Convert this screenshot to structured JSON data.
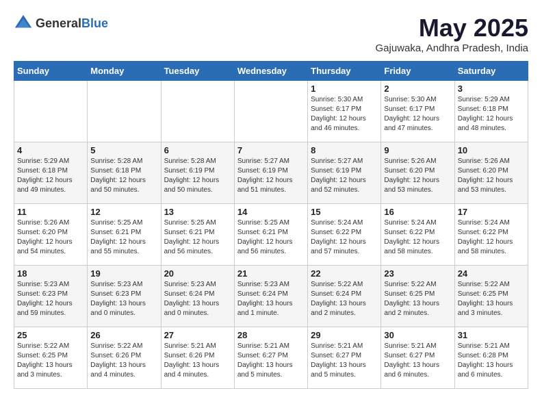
{
  "header": {
    "logo_general": "General",
    "logo_blue": "Blue",
    "month_title": "May 2025",
    "subtitle": "Gajuwaka, Andhra Pradesh, India"
  },
  "days_of_week": [
    "Sunday",
    "Monday",
    "Tuesday",
    "Wednesday",
    "Thursday",
    "Friday",
    "Saturday"
  ],
  "weeks": [
    [
      {
        "day": "",
        "info": ""
      },
      {
        "day": "",
        "info": ""
      },
      {
        "day": "",
        "info": ""
      },
      {
        "day": "",
        "info": ""
      },
      {
        "day": "1",
        "info": "Sunrise: 5:30 AM\nSunset: 6:17 PM\nDaylight: 12 hours\nand 46 minutes."
      },
      {
        "day": "2",
        "info": "Sunrise: 5:30 AM\nSunset: 6:17 PM\nDaylight: 12 hours\nand 47 minutes."
      },
      {
        "day": "3",
        "info": "Sunrise: 5:29 AM\nSunset: 6:18 PM\nDaylight: 12 hours\nand 48 minutes."
      }
    ],
    [
      {
        "day": "4",
        "info": "Sunrise: 5:29 AM\nSunset: 6:18 PM\nDaylight: 12 hours\nand 49 minutes."
      },
      {
        "day": "5",
        "info": "Sunrise: 5:28 AM\nSunset: 6:18 PM\nDaylight: 12 hours\nand 50 minutes."
      },
      {
        "day": "6",
        "info": "Sunrise: 5:28 AM\nSunset: 6:19 PM\nDaylight: 12 hours\nand 50 minutes."
      },
      {
        "day": "7",
        "info": "Sunrise: 5:27 AM\nSunset: 6:19 PM\nDaylight: 12 hours\nand 51 minutes."
      },
      {
        "day": "8",
        "info": "Sunrise: 5:27 AM\nSunset: 6:19 PM\nDaylight: 12 hours\nand 52 minutes."
      },
      {
        "day": "9",
        "info": "Sunrise: 5:26 AM\nSunset: 6:20 PM\nDaylight: 12 hours\nand 53 minutes."
      },
      {
        "day": "10",
        "info": "Sunrise: 5:26 AM\nSunset: 6:20 PM\nDaylight: 12 hours\nand 53 minutes."
      }
    ],
    [
      {
        "day": "11",
        "info": "Sunrise: 5:26 AM\nSunset: 6:20 PM\nDaylight: 12 hours\nand 54 minutes."
      },
      {
        "day": "12",
        "info": "Sunrise: 5:25 AM\nSunset: 6:21 PM\nDaylight: 12 hours\nand 55 minutes."
      },
      {
        "day": "13",
        "info": "Sunrise: 5:25 AM\nSunset: 6:21 PM\nDaylight: 12 hours\nand 56 minutes."
      },
      {
        "day": "14",
        "info": "Sunrise: 5:25 AM\nSunset: 6:21 PM\nDaylight: 12 hours\nand 56 minutes."
      },
      {
        "day": "15",
        "info": "Sunrise: 5:24 AM\nSunset: 6:22 PM\nDaylight: 12 hours\nand 57 minutes."
      },
      {
        "day": "16",
        "info": "Sunrise: 5:24 AM\nSunset: 6:22 PM\nDaylight: 12 hours\nand 58 minutes."
      },
      {
        "day": "17",
        "info": "Sunrise: 5:24 AM\nSunset: 6:22 PM\nDaylight: 12 hours\nand 58 minutes."
      }
    ],
    [
      {
        "day": "18",
        "info": "Sunrise: 5:23 AM\nSunset: 6:23 PM\nDaylight: 12 hours\nand 59 minutes."
      },
      {
        "day": "19",
        "info": "Sunrise: 5:23 AM\nSunset: 6:23 PM\nDaylight: 13 hours\nand 0 minutes."
      },
      {
        "day": "20",
        "info": "Sunrise: 5:23 AM\nSunset: 6:24 PM\nDaylight: 13 hours\nand 0 minutes."
      },
      {
        "day": "21",
        "info": "Sunrise: 5:23 AM\nSunset: 6:24 PM\nDaylight: 13 hours\nand 1 minute."
      },
      {
        "day": "22",
        "info": "Sunrise: 5:22 AM\nSunset: 6:24 PM\nDaylight: 13 hours\nand 2 minutes."
      },
      {
        "day": "23",
        "info": "Sunrise: 5:22 AM\nSunset: 6:25 PM\nDaylight: 13 hours\nand 2 minutes."
      },
      {
        "day": "24",
        "info": "Sunrise: 5:22 AM\nSunset: 6:25 PM\nDaylight: 13 hours\nand 3 minutes."
      }
    ],
    [
      {
        "day": "25",
        "info": "Sunrise: 5:22 AM\nSunset: 6:25 PM\nDaylight: 13 hours\nand 3 minutes."
      },
      {
        "day": "26",
        "info": "Sunrise: 5:22 AM\nSunset: 6:26 PM\nDaylight: 13 hours\nand 4 minutes."
      },
      {
        "day": "27",
        "info": "Sunrise: 5:21 AM\nSunset: 6:26 PM\nDaylight: 13 hours\nand 4 minutes."
      },
      {
        "day": "28",
        "info": "Sunrise: 5:21 AM\nSunset: 6:27 PM\nDaylight: 13 hours\nand 5 minutes."
      },
      {
        "day": "29",
        "info": "Sunrise: 5:21 AM\nSunset: 6:27 PM\nDaylight: 13 hours\nand 5 minutes."
      },
      {
        "day": "30",
        "info": "Sunrise: 5:21 AM\nSunset: 6:27 PM\nDaylight: 13 hours\nand 6 minutes."
      },
      {
        "day": "31",
        "info": "Sunrise: 5:21 AM\nSunset: 6:28 PM\nDaylight: 13 hours\nand 6 minutes."
      }
    ]
  ]
}
